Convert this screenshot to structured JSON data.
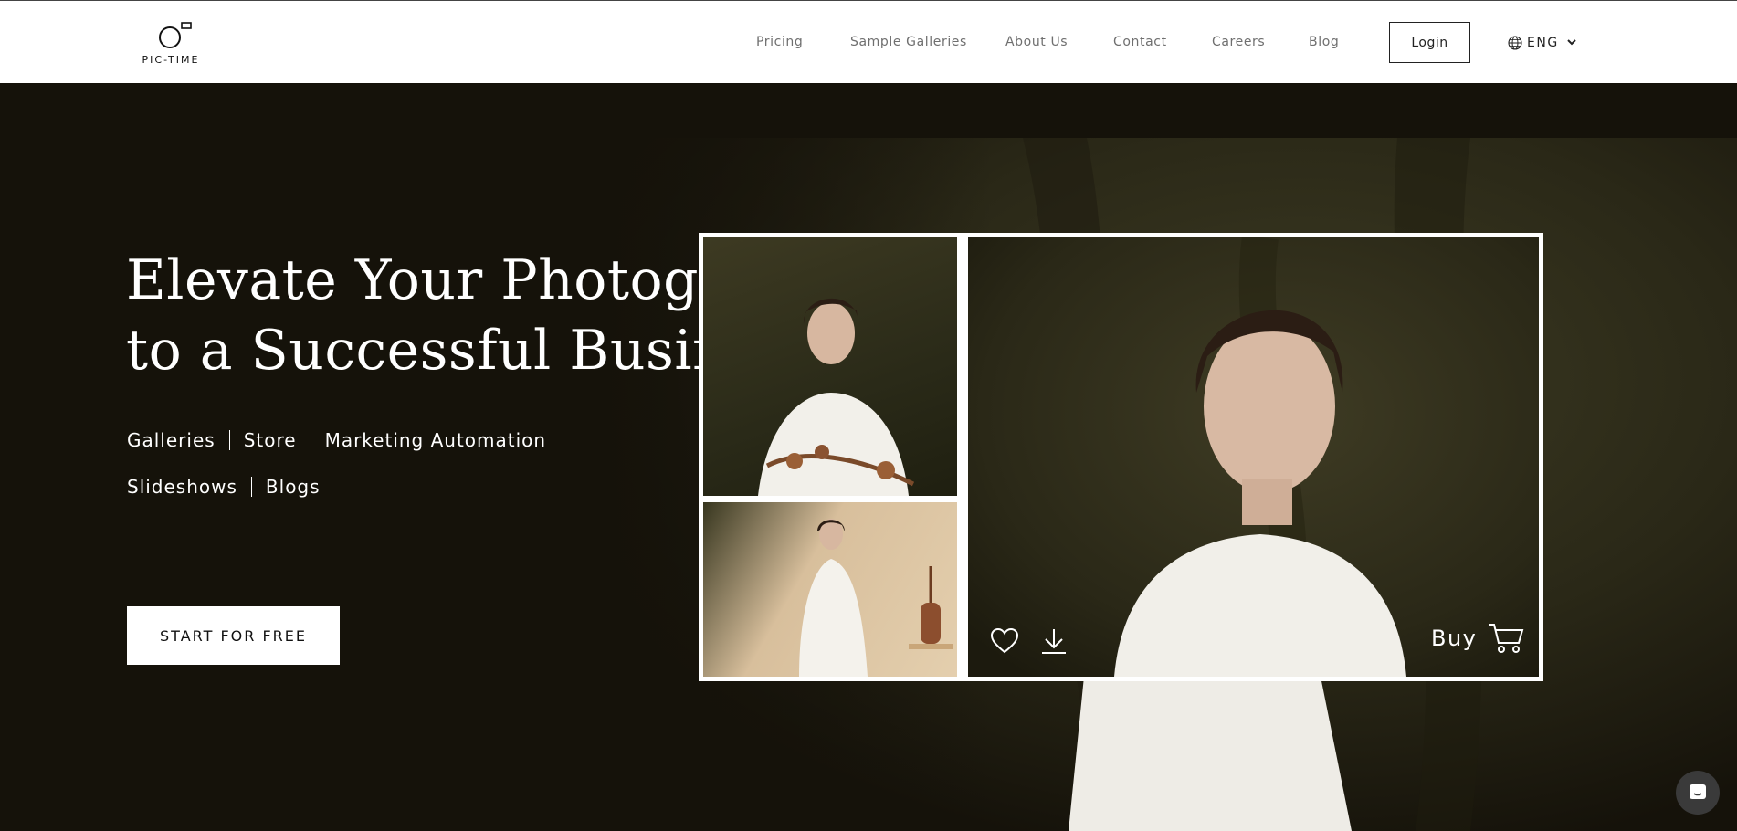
{
  "header": {
    "logo_text": "PIC-TIME",
    "nav": [
      "Pricing",
      "Sample Galleries",
      "About Us",
      "Contact",
      "Careers",
      "Blog"
    ],
    "login_label": "Login",
    "language": "ENG"
  },
  "hero": {
    "headline_line1": "Elevate Your Photography",
    "headline_line2": "to a Successful Business",
    "features_row1": [
      "Galleries",
      "Store",
      "Marketing Automation"
    ],
    "features_row2": [
      "Slideshows",
      "Blogs"
    ],
    "cta_label": "START FOR FREE"
  },
  "mockup": {
    "buy_label": "Buy"
  },
  "colors": {
    "background": "#15120a",
    "header": "#ffffff",
    "nav_text": "#6f6f6f",
    "accent": "#ffffff"
  },
  "icons": {
    "logo": "pic-time-logo",
    "globe": "globe-icon",
    "chevron": "chevron-down-icon",
    "heart": "heart-icon",
    "download": "download-icon",
    "cart": "cart-icon",
    "chat": "chat-icon"
  }
}
